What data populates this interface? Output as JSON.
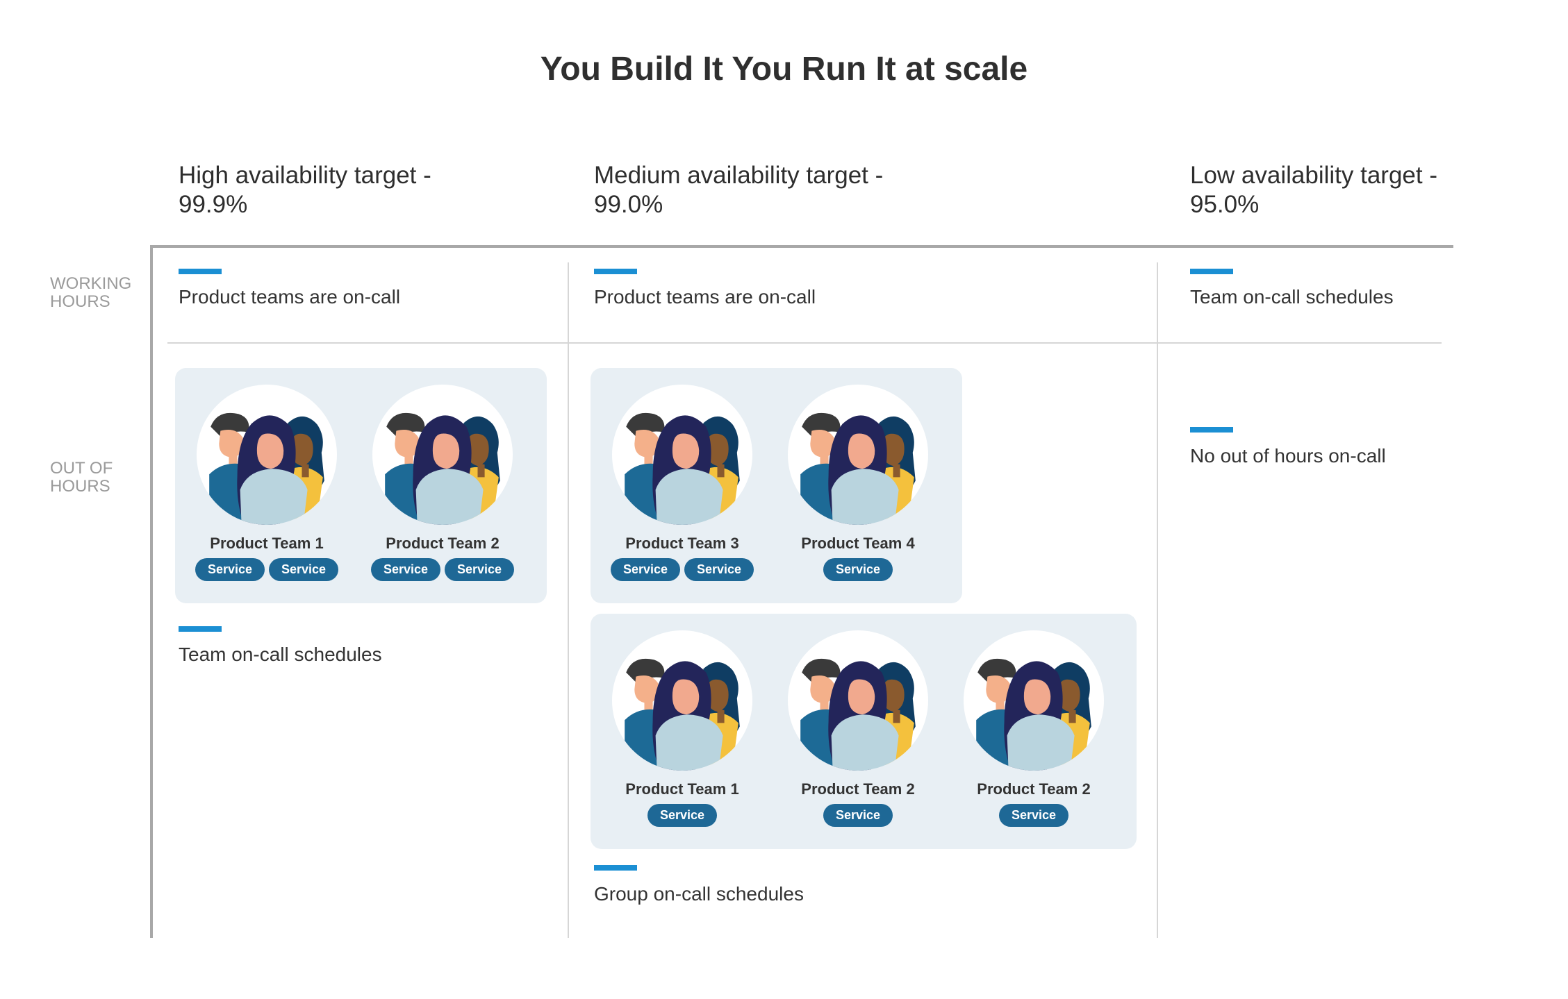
{
  "title": "You Build It You Run It at scale",
  "columns": [
    {
      "heading": "High availability target -\n99.9%"
    },
    {
      "heading": "Medium availability target -\n99.0%"
    },
    {
      "heading": "Low availability target -\n95.0%"
    }
  ],
  "rows": {
    "working": "WORKING\nHOURS",
    "out_of_hours": "OUT OF\nHOURS"
  },
  "captions": {
    "high_working": "Product teams are on-call",
    "medium_working": "Product teams are on-call",
    "low_working": "Team on-call schedules",
    "high_out": "Team on-call schedules",
    "medium_out": "Group on-call schedules",
    "low_out": "No out of hours on-call"
  },
  "service_label": "Service",
  "panels": {
    "high": [
      {
        "name": "Product Team 1",
        "services": 2
      },
      {
        "name": "Product Team 2",
        "services": 2
      }
    ],
    "medium_top": [
      {
        "name": "Product Team 3",
        "services": 2
      },
      {
        "name": "Product Team 4",
        "services": 1
      }
    ],
    "medium_bottom": [
      {
        "name": "Product Team 1",
        "services": 1
      },
      {
        "name": "Product Team 2",
        "services": 1
      },
      {
        "name": "Product Team 2",
        "services": 1
      }
    ]
  },
  "colors": {
    "accent": "#1b8fd3",
    "pill": "#1e6896",
    "panel": "#e8eff4"
  },
  "icons": {
    "team_avatar": "team-people-icon"
  }
}
